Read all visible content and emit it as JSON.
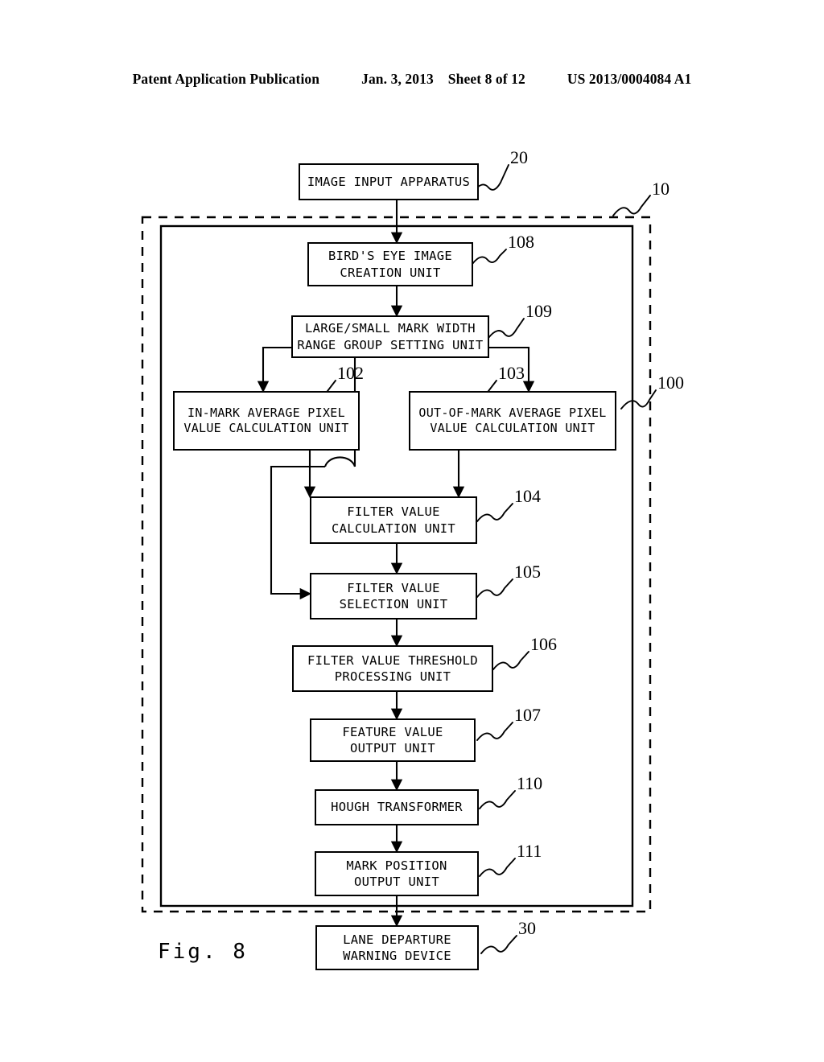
{
  "header": {
    "title": "Patent Application Publication",
    "date": "Jan. 3, 2013",
    "sheet": "Sheet 8 of 12",
    "publication_number": "US 2013/0004084 A1"
  },
  "figure": {
    "caption": "Fig. 8",
    "nodes": [
      {
        "id": "n20",
        "label": "IMAGE INPUT APPARATUS",
        "ref": "20"
      },
      {
        "id": "n108",
        "label": "BIRD'S EYE IMAGE\nCREATION UNIT",
        "ref": "108"
      },
      {
        "id": "n109",
        "label": "LARGE/SMALL MARK WIDTH\nRANGE GROUP SETTING UNIT",
        "ref": "109"
      },
      {
        "id": "n102",
        "label": "IN-MARK AVERAGE PIXEL\nVALUE CALCULATION UNIT",
        "ref": "102"
      },
      {
        "id": "n103",
        "label": "OUT-OF-MARK AVERAGE PIXEL\nVALUE CALCULATION UNIT",
        "ref": "103"
      },
      {
        "id": "n104",
        "label": "FILTER VALUE\nCALCULATION UNIT",
        "ref": "104"
      },
      {
        "id": "n105",
        "label": "FILTER VALUE\nSELECTION UNIT",
        "ref": "105"
      },
      {
        "id": "n106",
        "label": "FILTER VALUE THRESHOLD\nPROCESSING UNIT",
        "ref": "106"
      },
      {
        "id": "n107",
        "label": "FEATURE VALUE\nOUTPUT UNIT",
        "ref": "107"
      },
      {
        "id": "n110",
        "label": "HOUGH TRANSFORMER",
        "ref": "110"
      },
      {
        "id": "n111",
        "label": "MARK POSITION\nOUTPUT UNIT",
        "ref": "111"
      },
      {
        "id": "n30",
        "label": "LANE DEPARTURE\nWARNING DEVICE",
        "ref": "30"
      }
    ],
    "containers": [
      {
        "id": "dashed-system-boundary",
        "ref": "10"
      },
      {
        "id": "solid-device-boundary",
        "ref": "100"
      }
    ],
    "line_color": "#000000"
  }
}
